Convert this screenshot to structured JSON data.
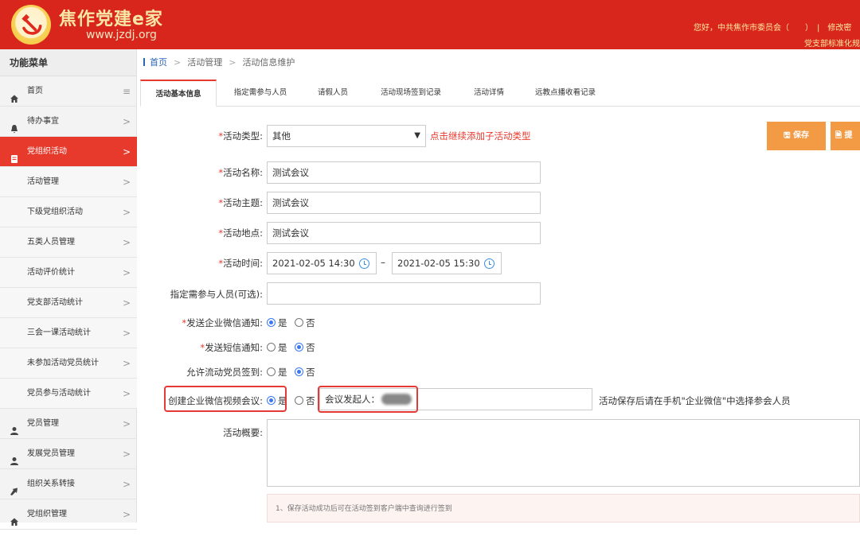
{
  "header": {
    "site_name": "焦作党建e家",
    "site_url": "www.jzdj.org",
    "greeting": "您好，中共焦作市委员会（　　）　|　修改密",
    "sub": "党支部标准化规"
  },
  "sidebar": {
    "title": "功能菜单",
    "items": [
      {
        "label": "首页",
        "icon": "home-icon",
        "chevron": "≡"
      },
      {
        "label": "待办事宜",
        "icon": "bell-icon",
        "chevron": ">"
      },
      {
        "label": "党组织活动",
        "icon": "document-icon",
        "chevron": ">"
      },
      {
        "label": "活动管理",
        "chevron": ">"
      },
      {
        "label": "下级党组织活动",
        "chevron": ">"
      },
      {
        "label": "五类人员管理",
        "chevron": ">"
      },
      {
        "label": "活动评价统计",
        "chevron": ">"
      },
      {
        "label": "党支部活动统计",
        "chevron": ">"
      },
      {
        "label": "三会一课活动统计",
        "chevron": ">"
      },
      {
        "label": "未参加活动党员统计",
        "chevron": ">"
      },
      {
        "label": "党员参与活动统计",
        "chevron": ">"
      },
      {
        "label": "党员管理",
        "icon": "user-icon",
        "chevron": ">"
      },
      {
        "label": "发展党员管理",
        "icon": "user-icon",
        "chevron": ">"
      },
      {
        "label": "组织关系转接",
        "icon": "arrow-icon",
        "chevron": ">"
      },
      {
        "label": "党组织管理",
        "icon": "home-icon",
        "chevron": ">"
      }
    ]
  },
  "breadcrumb": {
    "home": "首页",
    "level1": "活动管理",
    "level2": "活动信息维护",
    "sep": ">"
  },
  "tabs": [
    "活动基本信息",
    "指定需参与人员",
    "请假人员",
    "活动现场签到记录",
    "活动详情",
    "远教点播收看记录"
  ],
  "form": {
    "type_label": "活动类型:",
    "type_value": "其他",
    "type_hint": "点击继续添加子活动类型",
    "name_label": "活动名称:",
    "name_value": "测试会议",
    "theme_label": "活动主题:",
    "theme_value": "测试会议",
    "place_label": "活动地点:",
    "place_value": "测试会议",
    "time_label": "活动时间:",
    "time_start": "2021-02-05 14:30",
    "time_end": "2021-02-05 15:30",
    "time_sep": "–",
    "participants_label": "指定需参与人员(可选):",
    "wechat_notice_label": "发送企业微信通知:",
    "sms_notice_label": "发送短信通知:",
    "mobile_sign_label": "允许流动党员签到:",
    "video_meeting_label": "创建企业微信视频会议:",
    "yes": "是",
    "no": "否",
    "initiator_label": "会议发起人：",
    "video_hint": "活动保存后请在手机\"企业微信\"中选择参会人员",
    "summary_label": "活动概要:",
    "required_mark": "*"
  },
  "radios": {
    "wechat_notice": "yes",
    "sms_notice": "no",
    "mobile_sign": "no",
    "video_meeting": "yes"
  },
  "buttons": {
    "save": "保存",
    "other": "提"
  },
  "notice": "1、保存活动成功后可在活动签到客户端中查询进行签到",
  "colors": {
    "header": "#d9261c",
    "accent": "#e8392d",
    "button": "#f39a45",
    "link": "#2a66b8"
  }
}
